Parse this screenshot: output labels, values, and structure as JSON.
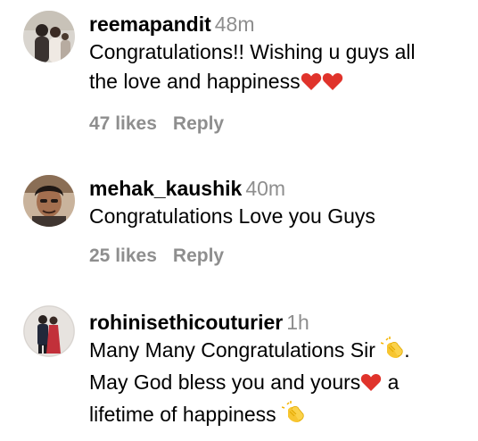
{
  "comments": [
    {
      "username": "reemapandit",
      "time": "48m",
      "lines": [
        "Congratulations!! Wishing u guys all",
        "the love and happiness"
      ],
      "likes": "47 likes",
      "reply": "Reply"
    },
    {
      "username": "mehak_kaushik",
      "time": "40m",
      "lines": [
        "Congratulations Love you Guys"
      ],
      "likes": "25 likes",
      "reply": "Reply"
    },
    {
      "username": "rohinisethicouturier",
      "time": "1h",
      "lines": [
        "Many Many Congratulations Sir",
        "May God bless you and yours",
        "a",
        "lifetime of happiness"
      ],
      "reply": ""
    }
  ],
  "colors": {
    "text": "#000000",
    "muted": "#8e8e8e",
    "heart": "#e0332b"
  },
  "icons": [
    "heart-emoji",
    "clapping-hands-emoji"
  ]
}
